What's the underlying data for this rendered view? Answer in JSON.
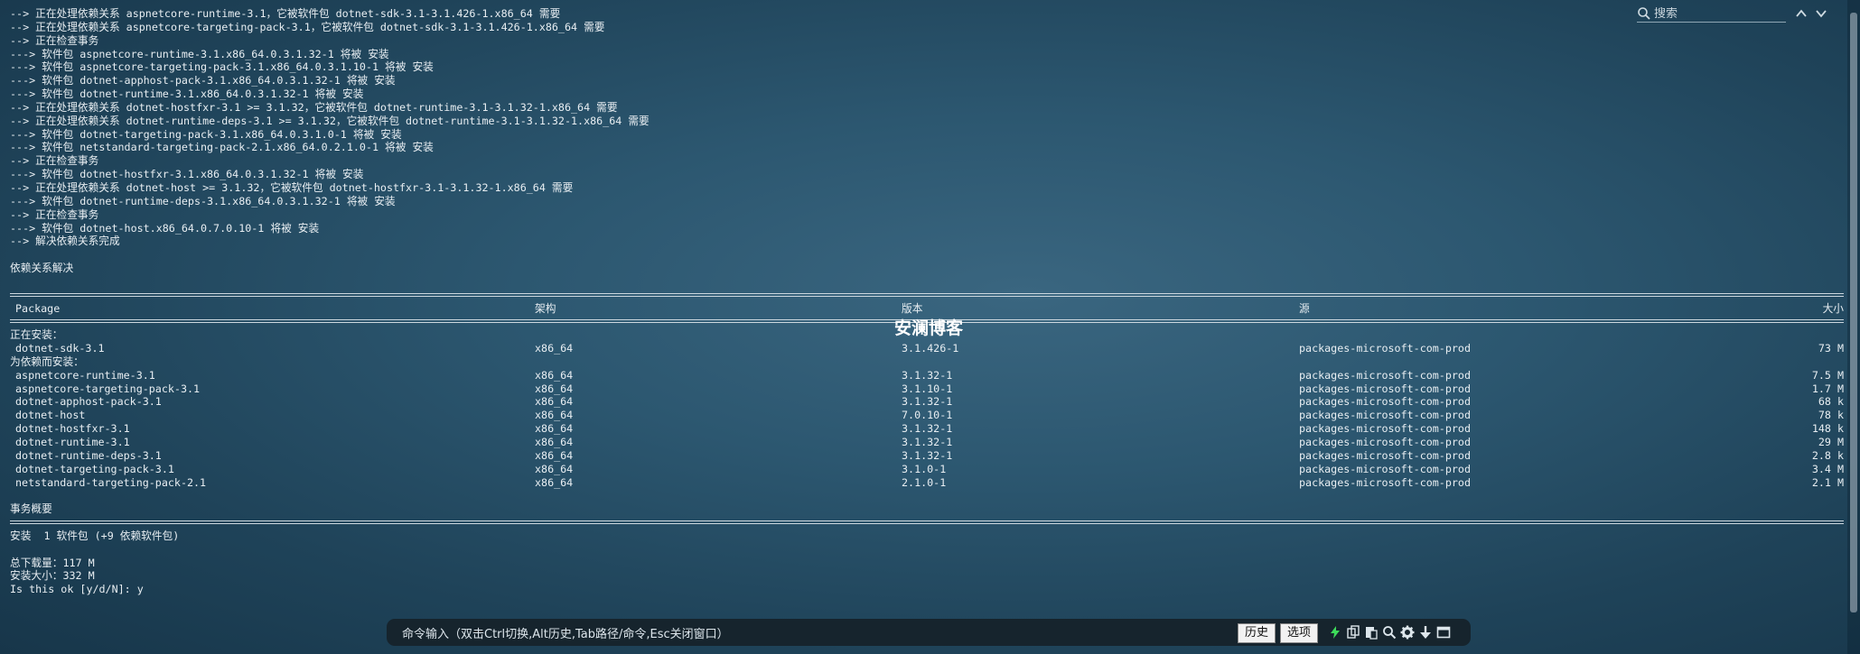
{
  "terminal": {
    "log_lines": [
      "--> 正在处理依赖关系 aspnetcore-runtime-3.1，它被软件包 dotnet-sdk-3.1-3.1.426-1.x86_64 需要",
      "--> 正在处理依赖关系 aspnetcore-targeting-pack-3.1，它被软件包 dotnet-sdk-3.1-3.1.426-1.x86_64 需要",
      "--> 正在检查事务",
      "---> 软件包 aspnetcore-runtime-3.1.x86_64.0.3.1.32-1 将被 安装",
      "---> 软件包 aspnetcore-targeting-pack-3.1.x86_64.0.3.1.10-1 将被 安装",
      "---> 软件包 dotnet-apphost-pack-3.1.x86_64.0.3.1.32-1 将被 安装",
      "---> 软件包 dotnet-runtime-3.1.x86_64.0.3.1.32-1 将被 安装",
      "--> 正在处理依赖关系 dotnet-hostfxr-3.1 >= 3.1.32，它被软件包 dotnet-runtime-3.1-3.1.32-1.x86_64 需要",
      "--> 正在处理依赖关系 dotnet-runtime-deps-3.1 >= 3.1.32，它被软件包 dotnet-runtime-3.1-3.1.32-1.x86_64 需要",
      "---> 软件包 dotnet-targeting-pack-3.1.x86_64.0.3.1.0-1 将被 安装",
      "---> 软件包 netstandard-targeting-pack-2.1.x86_64.0.2.1.0-1 将被 安装",
      "--> 正在检查事务",
      "---> 软件包 dotnet-hostfxr-3.1.x86_64.0.3.1.32-1 将被 安装",
      "--> 正在处理依赖关系 dotnet-host >= 3.1.32，它被软件包 dotnet-hostfxr-3.1-3.1.32-1.x86_64 需要",
      "---> 软件包 dotnet-runtime-deps-3.1.x86_64.0.3.1.32-1 将被 安装",
      "--> 正在检查事务",
      "---> 软件包 dotnet-host.x86_64.0.7.0.10-1 将被 安装",
      "--> 解决依赖关系完成"
    ],
    "resolved_heading": "依赖关系解决",
    "table": {
      "headers": {
        "package": "Package",
        "arch": "架构",
        "version": "版本",
        "repo": "源",
        "size": "大小"
      },
      "installing_label": "正在安装：",
      "installing": [
        {
          "name": "dotnet-sdk-3.1",
          "arch": "x86_64",
          "version": "3.1.426-1",
          "repo": "packages-microsoft-com-prod",
          "size": "73 M"
        }
      ],
      "deps_label": "为依赖而安装：",
      "dependencies": [
        {
          "name": "aspnetcore-runtime-3.1",
          "arch": "x86_64",
          "version": "3.1.32-1",
          "repo": "packages-microsoft-com-prod",
          "size": "7.5 M"
        },
        {
          "name": "aspnetcore-targeting-pack-3.1",
          "arch": "x86_64",
          "version": "3.1.10-1",
          "repo": "packages-microsoft-com-prod",
          "size": "1.7 M"
        },
        {
          "name": "dotnet-apphost-pack-3.1",
          "arch": "x86_64",
          "version": "3.1.32-1",
          "repo": "packages-microsoft-com-prod",
          "size": "68 k"
        },
        {
          "name": "dotnet-host",
          "arch": "x86_64",
          "version": "7.0.10-1",
          "repo": "packages-microsoft-com-prod",
          "size": "78 k"
        },
        {
          "name": "dotnet-hostfxr-3.1",
          "arch": "x86_64",
          "version": "3.1.32-1",
          "repo": "packages-microsoft-com-prod",
          "size": "148 k"
        },
        {
          "name": "dotnet-runtime-3.1",
          "arch": "x86_64",
          "version": "3.1.32-1",
          "repo": "packages-microsoft-com-prod",
          "size": "29 M"
        },
        {
          "name": "dotnet-runtime-deps-3.1",
          "arch": "x86_64",
          "version": "3.1.32-1",
          "repo": "packages-microsoft-com-prod",
          "size": "2.8 k"
        },
        {
          "name": "dotnet-targeting-pack-3.1",
          "arch": "x86_64",
          "version": "3.1.0-1",
          "repo": "packages-microsoft-com-prod",
          "size": "3.4 M"
        },
        {
          "name": "netstandard-targeting-pack-2.1",
          "arch": "x86_64",
          "version": "2.1.0-1",
          "repo": "packages-microsoft-com-prod",
          "size": "2.1 M"
        }
      ]
    },
    "summary_heading": "事务概要",
    "install_summary": "安装  1 软件包 (+9 依赖软件包)",
    "total_download": "总下载量：117 M",
    "install_size": "安装大小：332 M",
    "prompt": "Is this ok [y/d/N]: y"
  },
  "watermark": "安澜博客",
  "search": {
    "placeholder": "搜索"
  },
  "command_bar": {
    "label": "命令输入（双击Ctrl切换,Alt历史,Tab路径/命令,Esc关闭窗口）",
    "history_button": "历史",
    "options_button": "选项"
  },
  "icons": {
    "search": "search-icon",
    "up": "chevron-up-icon",
    "down": "chevron-down-icon",
    "lightning": "lightning-icon",
    "copy": "copy-icon",
    "paste": "paste-icon",
    "find": "find-icon",
    "settings": "gear-icon",
    "download": "arrow-down-icon",
    "window": "window-icon"
  },
  "colors": {
    "accent_green": "#3ddc5a",
    "bar_bg": "#16242d"
  }
}
